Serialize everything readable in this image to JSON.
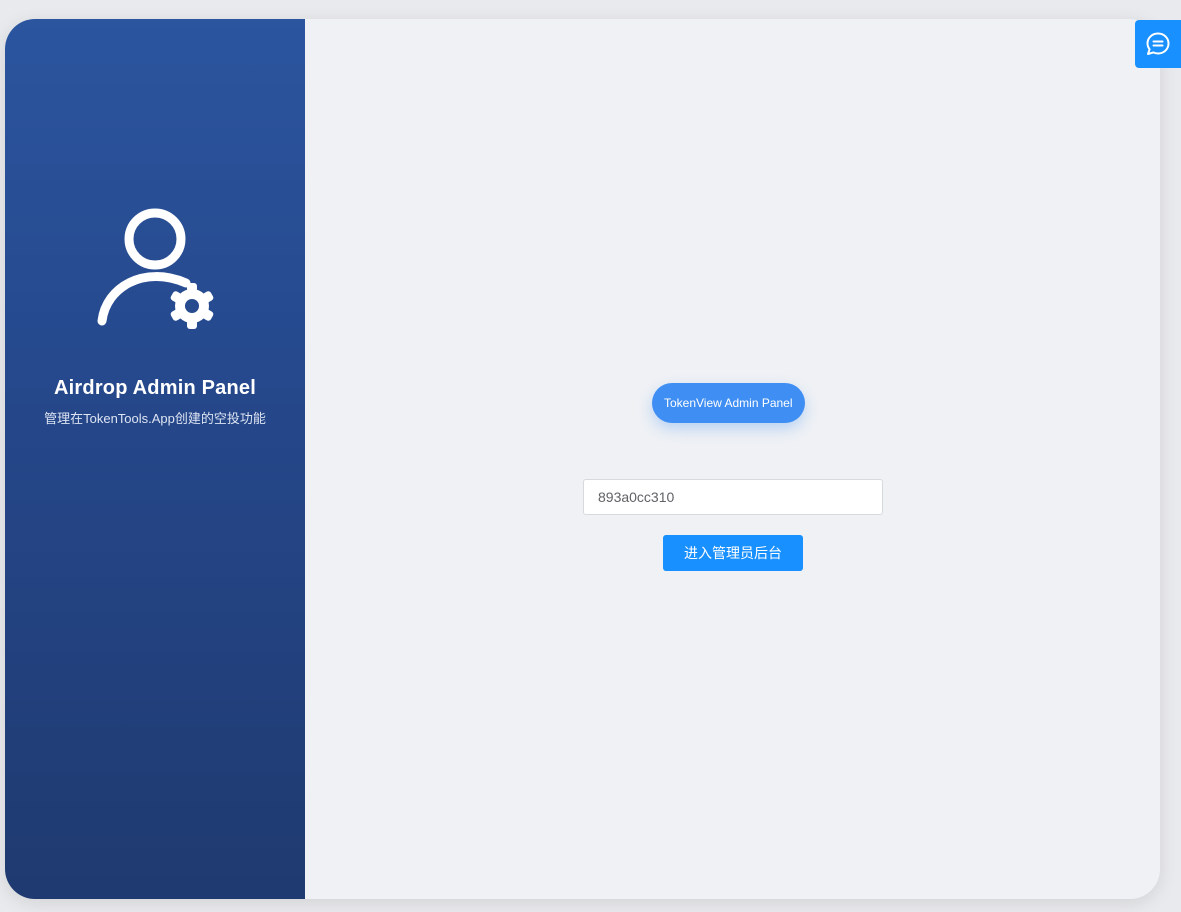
{
  "sidebar": {
    "icon": "user-settings-icon",
    "title": "Airdrop Admin Panel",
    "subtitle": "管理在TokenTools.App创建的空投功能"
  },
  "main": {
    "pill_label": "TokenView Admin Panel",
    "code_input": {
      "value": "893a0cc310",
      "placeholder": ""
    },
    "enter_button_label": "进入管理员后台"
  },
  "chat": {
    "icon": "chat-bubble-icon"
  },
  "colors": {
    "sidebar_top": "#2b559f",
    "sidebar_bottom": "#1f3a70",
    "accent": "#1890ff",
    "pill": "#3f8ef3",
    "background": "#eff1f5"
  }
}
